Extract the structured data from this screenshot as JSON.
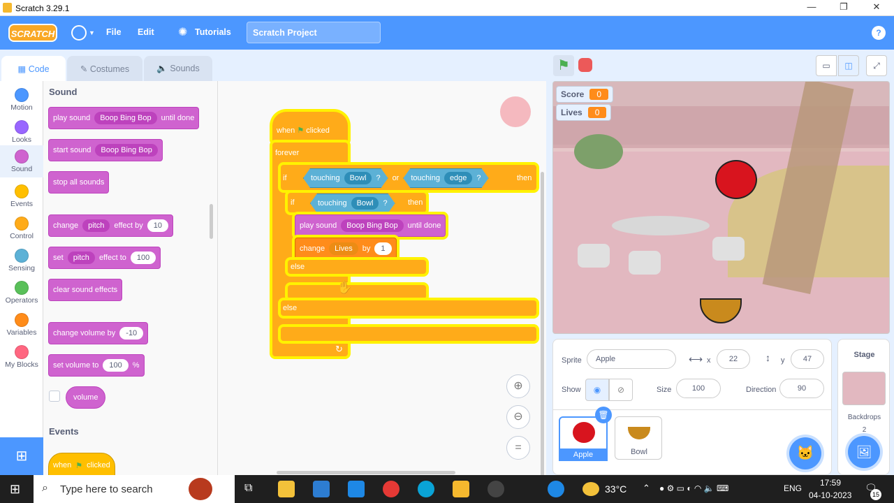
{
  "window": {
    "title": "Scratch 3.29.1",
    "min": "—",
    "max": "❐",
    "close": "✕"
  },
  "menu": {
    "logo": "SCRATCH",
    "file": "File",
    "edit": "Edit",
    "tutorials": "Tutorials",
    "project": "Scratch Project",
    "help": "?"
  },
  "tabs": [
    {
      "label": "Code"
    },
    {
      "label": "Costumes"
    },
    {
      "label": "Sounds"
    }
  ],
  "categories": [
    {
      "label": "Motion",
      "color": "#4c97ff"
    },
    {
      "label": "Looks",
      "color": "#9966ff"
    },
    {
      "label": "Sound",
      "color": "#cf63cf"
    },
    {
      "label": "Events",
      "color": "#ffbf00"
    },
    {
      "label": "Control",
      "color": "#ffab19"
    },
    {
      "label": "Sensing",
      "color": "#5cb1d6"
    },
    {
      "label": "Operators",
      "color": "#59c059"
    },
    {
      "label": "Variables",
      "color": "#ff8c1a"
    },
    {
      "label": "My Blocks",
      "color": "#ff6680"
    }
  ],
  "palette": {
    "heading_sound": "Sound",
    "heading_events": "Events",
    "play_until": {
      "a": "play sound",
      "dd": "Boop Bing Bop",
      "b": "until done"
    },
    "start_sound": {
      "a": "start sound",
      "dd": "Boop Bing Bop"
    },
    "stop_all": "stop all sounds",
    "change_effect": {
      "a": "change",
      "dd": "pitch",
      "b": "effect by",
      "n": "10"
    },
    "set_effect": {
      "a": "set",
      "dd": "pitch",
      "b": "effect to",
      "n": "100"
    },
    "clear_effects": "clear sound effects",
    "change_volume": {
      "a": "change volume by",
      "n": "-10"
    },
    "set_volume": {
      "a": "set volume to",
      "n": "100",
      "b": "%"
    },
    "volume": "volume",
    "when_flag": {
      "a": "when",
      "b": "clicked"
    }
  },
  "script": {
    "hat": {
      "a": "when",
      "b": "clicked"
    },
    "forever": "forever",
    "if1": {
      "kw": "if",
      "t1": "touching",
      "dd1": "Bowl",
      "q": "?",
      "or": "or",
      "t2": "touching",
      "dd2": "edge",
      "then": "then"
    },
    "if2": {
      "kw": "if",
      "t1": "touching",
      "dd1": "Bowl",
      "q": "?",
      "then": "then"
    },
    "play": {
      "a": "play sound",
      "dd": "Boop Bing Bop",
      "b": "until done"
    },
    "change": {
      "a": "change",
      "dd": "Lives",
      "b": "by",
      "n": "1"
    },
    "else": "else"
  },
  "stage": {
    "monitors": [
      {
        "label": "Score",
        "value": "0"
      },
      {
        "label": "Lives",
        "value": "0"
      }
    ]
  },
  "sprite": {
    "label": "Sprite",
    "name": "Apple",
    "x_label": "x",
    "x": "22",
    "y_label": "y",
    "y": "47",
    "show": "Show",
    "size_label": "Size",
    "size": "100",
    "dir_label": "Direction",
    "dir": "90",
    "list": [
      {
        "name": "Apple"
      },
      {
        "name": "Bowl"
      }
    ]
  },
  "stagepanel": {
    "title": "Stage",
    "backdrops": "Backdrops",
    "count": "2"
  },
  "taskbar": {
    "search": "Type here to search",
    "temp": "33°C",
    "lang": "ENG",
    "time": "17:59",
    "date": "04-10-2023",
    "notif": "15"
  }
}
